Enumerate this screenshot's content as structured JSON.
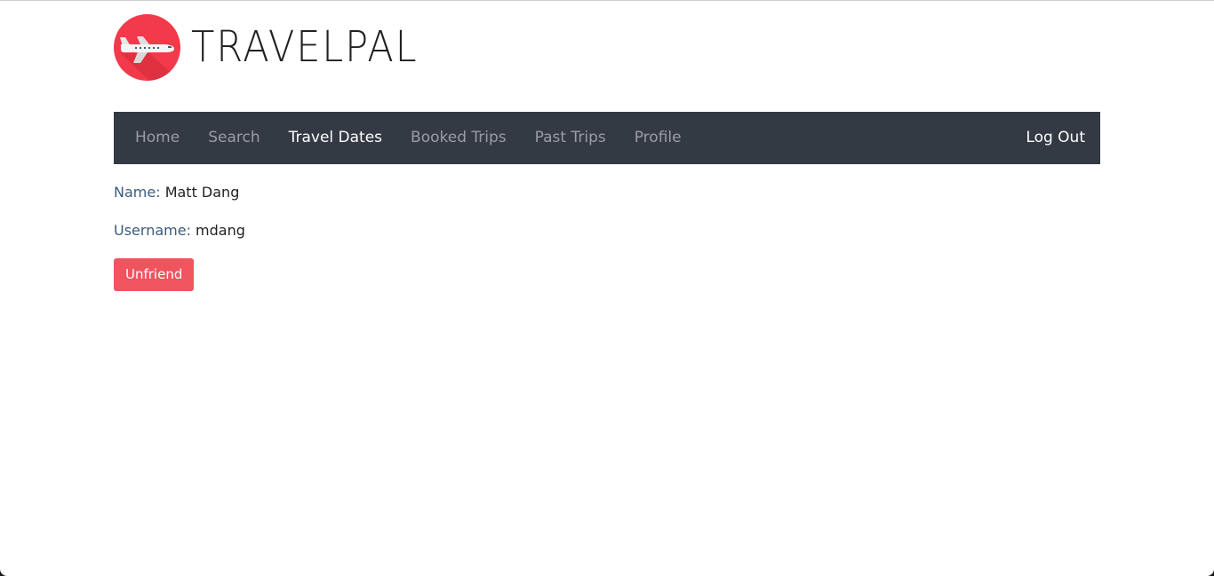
{
  "brand": {
    "name": "TRAVELPAL",
    "logo_icon": "airplane-icon",
    "logo_color": "#f23a4a"
  },
  "nav": {
    "items": [
      {
        "label": "Home",
        "active": false
      },
      {
        "label": "Search",
        "active": false
      },
      {
        "label": "Travel Dates",
        "active": true
      },
      {
        "label": "Booked Trips",
        "active": false
      },
      {
        "label": "Past Trips",
        "active": false
      },
      {
        "label": "Profile",
        "active": false
      }
    ],
    "logout_label": "Log Out",
    "background": "#343a43"
  },
  "profile": {
    "name_label": "Name:",
    "name_value": "Matt Dang",
    "username_label": "Username:",
    "username_value": "mdang"
  },
  "actions": {
    "unfriend_label": "Unfriend",
    "unfriend_color": "#f0545f"
  }
}
